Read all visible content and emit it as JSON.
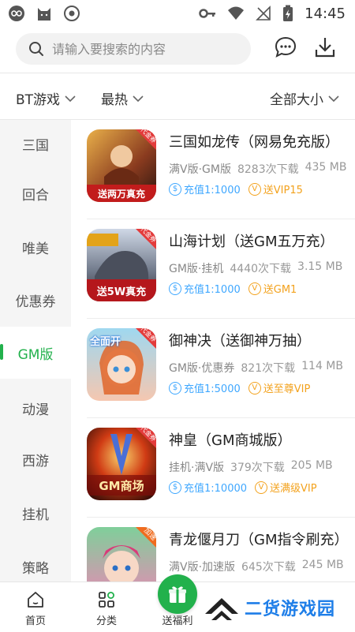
{
  "status_bar": {
    "time": "14:45"
  },
  "search": {
    "placeholder": "请输入要搜索的内容"
  },
  "filters": {
    "type": "BT游戏",
    "sort": "最热",
    "size": "全部大小"
  },
  "sidebar": {
    "active_index": 4,
    "items": [
      "三国",
      "回合",
      "唯美",
      "优惠券",
      "GM版",
      "动漫",
      "西游",
      "挂机",
      "策略"
    ]
  },
  "games": [
    {
      "title": "三国如龙传（网易免充版）",
      "tags": "满V版·GM版",
      "downloads": "8283次下载",
      "size": "435 MB",
      "recharge": "充值1:1000",
      "vip": "送VIP15",
      "icon_text": "送两万真充",
      "icon_corner": "代金券"
    },
    {
      "title": "山海计划（送GM五万充）",
      "tags": "GM版·挂机",
      "downloads": "4440次下载",
      "size": "3.15 MB",
      "recharge": "充值1:1000",
      "vip": "送GM1",
      "icon_text": "送5W真充",
      "icon_corner": "代金券"
    },
    {
      "title": "御神决（送御神万抽）",
      "tags": "GM版·优惠券",
      "downloads": "821次下载",
      "size": "114 MB",
      "recharge": "充值1:5000",
      "vip": "送至尊VIP",
      "icon_text": "全面开",
      "icon_corner": "代金券"
    },
    {
      "title": "神皇（GM商城版）",
      "tags": "挂机·满V版",
      "downloads": "379次下载",
      "size": "205 MB",
      "recharge": "充值1:10000",
      "vip": "送满级VIP",
      "icon_text": "GM商场",
      "icon_corner": "代金券"
    },
    {
      "title": "青龙偃月刀（GM指令刷充）",
      "tags": "满V版·加速版",
      "downloads": "645次下载",
      "size": "245 MB",
      "recharge": "",
      "vip": "",
      "icon_text": "",
      "icon_corner": "加速"
    }
  ],
  "bottom_nav": {
    "home": "首页",
    "category": "分类",
    "welfare": "送福利"
  },
  "watermark": {
    "text": "二货游戏园"
  },
  "colors": {
    "accent": "#22b14c",
    "recharge": "#3ea7ff",
    "vip": "#f3a21d"
  }
}
